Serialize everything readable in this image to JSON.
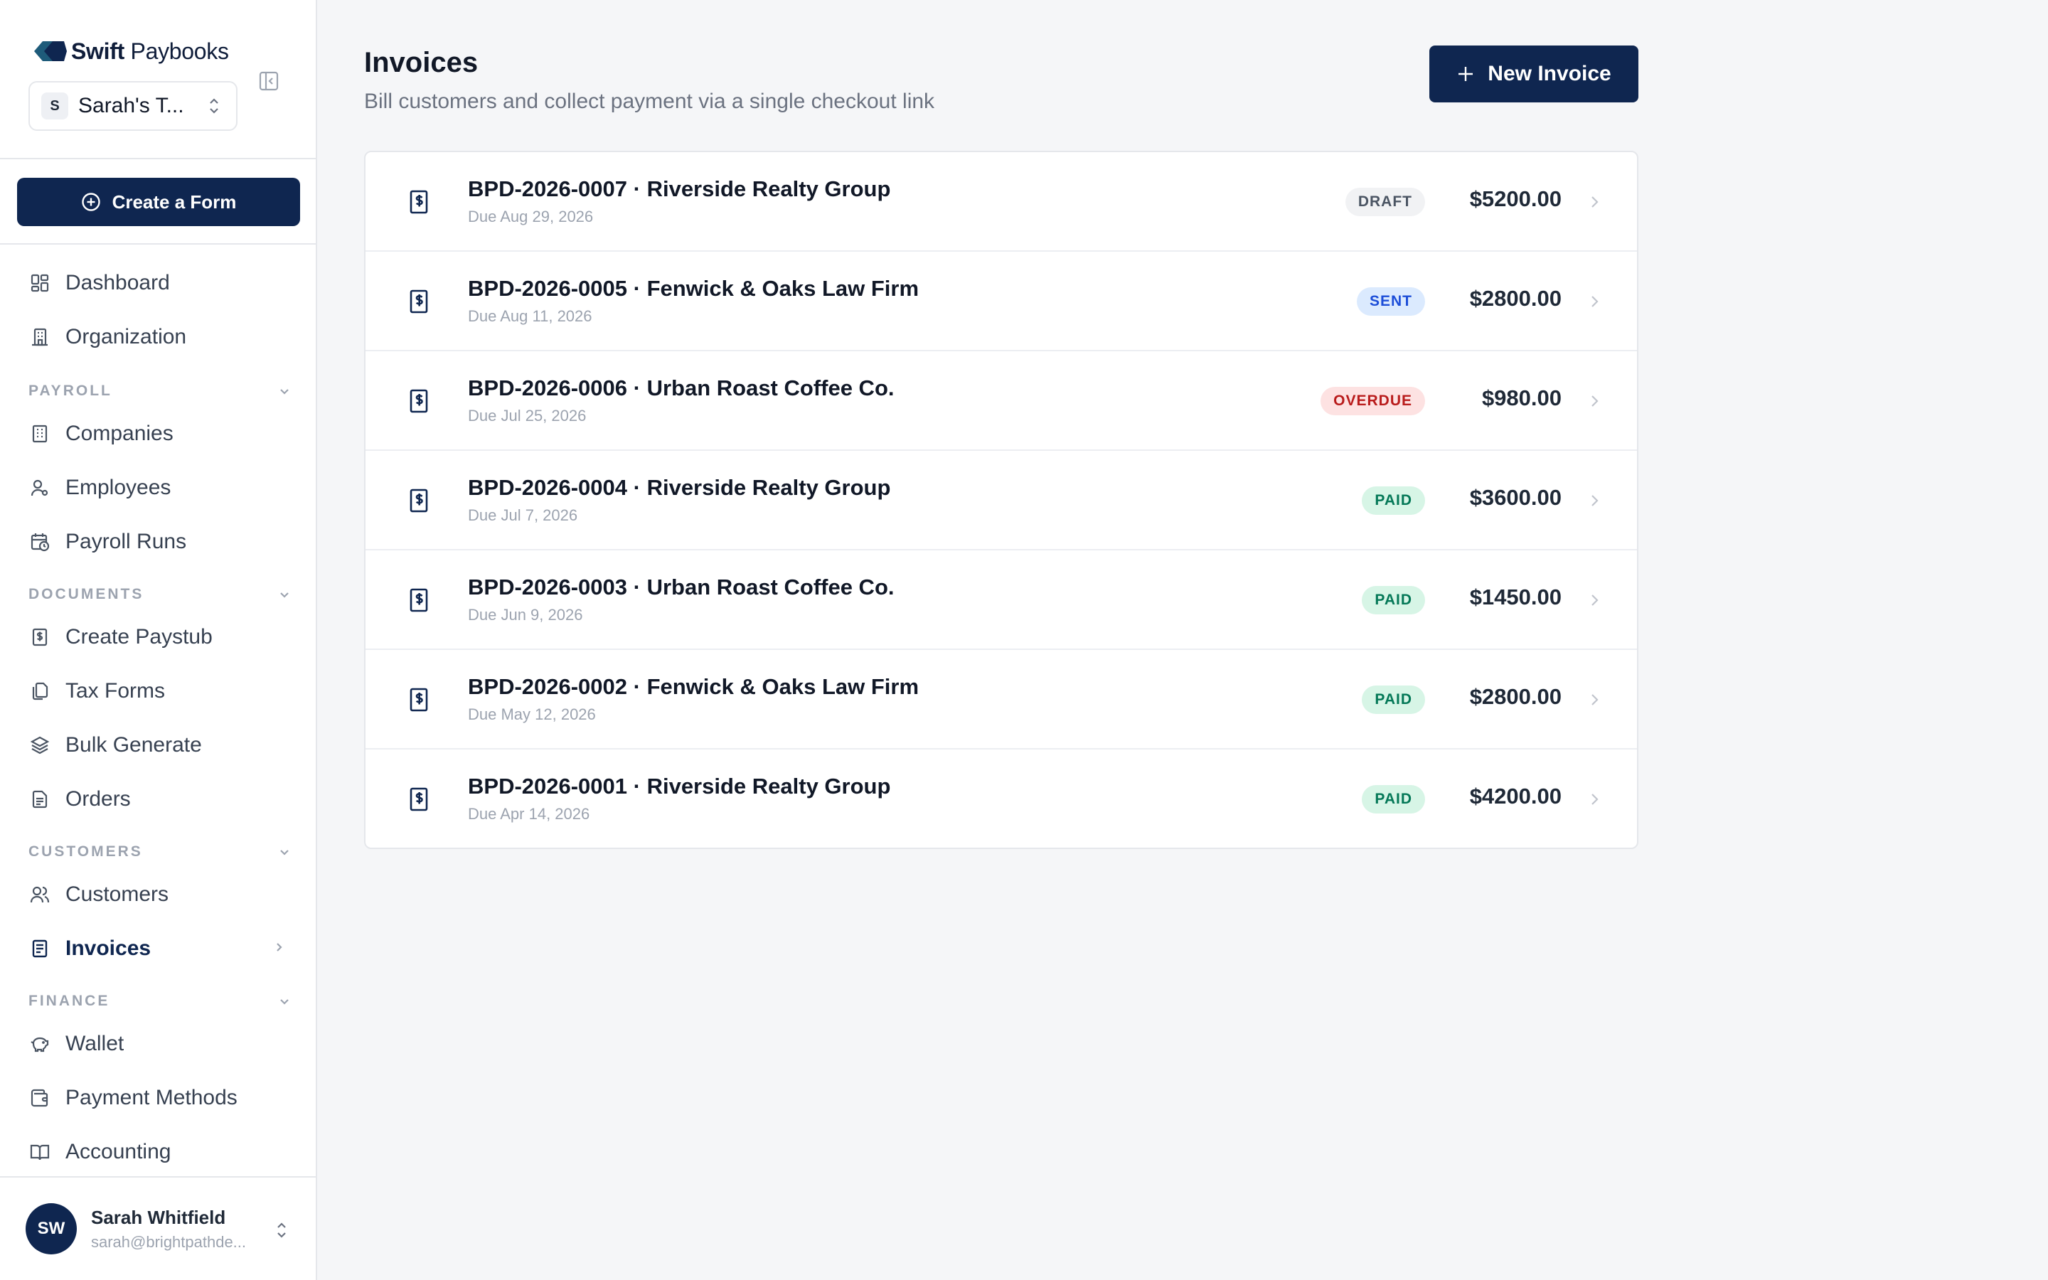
{
  "brand": {
    "name_bold": "Swift",
    "name_rest": " Paybooks"
  },
  "workspace": {
    "initial": "S",
    "name": "Sarah's T..."
  },
  "sidebar": {
    "create_form_label": "Create a Form",
    "items": {
      "dashboard": "Dashboard",
      "organization": "Organization",
      "companies": "Companies",
      "employees": "Employees",
      "payroll_runs": "Payroll Runs",
      "create_paystub": "Create Paystub",
      "tax_forms": "Tax Forms",
      "bulk_generate": "Bulk Generate",
      "orders": "Orders",
      "customers": "Customers",
      "invoices": "Invoices",
      "wallet": "Wallet",
      "payment_methods": "Payment Methods",
      "accounting": "Accounting"
    },
    "sections": {
      "payroll": "PAYROLL",
      "documents": "DOCUMENTS",
      "customers": "CUSTOMERS",
      "finance": "FINANCE"
    }
  },
  "user": {
    "initials": "SW",
    "name": "Sarah Whitfield",
    "email": "sarah@brightpathde..."
  },
  "main": {
    "title": "Invoices",
    "subtitle": "Bill customers and collect payment via a single checkout link",
    "new_invoice_label": "New Invoice",
    "invoices": [
      {
        "title": "BPD-2026-0007 · Riverside Realty Group",
        "due": "Due Aug 29, 2026",
        "status": "DRAFT",
        "amount": "$5200.00"
      },
      {
        "title": "BPD-2026-0005 · Fenwick & Oaks Law Firm",
        "due": "Due Aug 11, 2026",
        "status": "SENT",
        "amount": "$2800.00"
      },
      {
        "title": "BPD-2026-0006 · Urban Roast Coffee Co.",
        "due": "Due Jul 25, 2026",
        "status": "OVERDUE",
        "amount": "$980.00"
      },
      {
        "title": "BPD-2026-0004 · Riverside Realty Group",
        "due": "Due Jul 7, 2026",
        "status": "PAID",
        "amount": "$3600.00"
      },
      {
        "title": "BPD-2026-0003 · Urban Roast Coffee Co.",
        "due": "Due Jun 9, 2026",
        "status": "PAID",
        "amount": "$1450.00"
      },
      {
        "title": "BPD-2026-0002 · Fenwick & Oaks Law Firm",
        "due": "Due May 12, 2026",
        "status": "PAID",
        "amount": "$2800.00"
      },
      {
        "title": "BPD-2026-0001 · Riverside Realty Group",
        "due": "Due Apr 14, 2026",
        "status": "PAID",
        "amount": "$4200.00"
      }
    ]
  },
  "colors": {
    "primary": "#0f2650",
    "draft_bg": "#f1f2f4",
    "draft_fg": "#4b5563",
    "sent_bg": "#dbeafe",
    "sent_fg": "#1d4ed8",
    "overdue_bg": "#fde2e2",
    "overdue_fg": "#b91c1c",
    "paid_bg": "#d7f5e6",
    "paid_fg": "#047857"
  }
}
